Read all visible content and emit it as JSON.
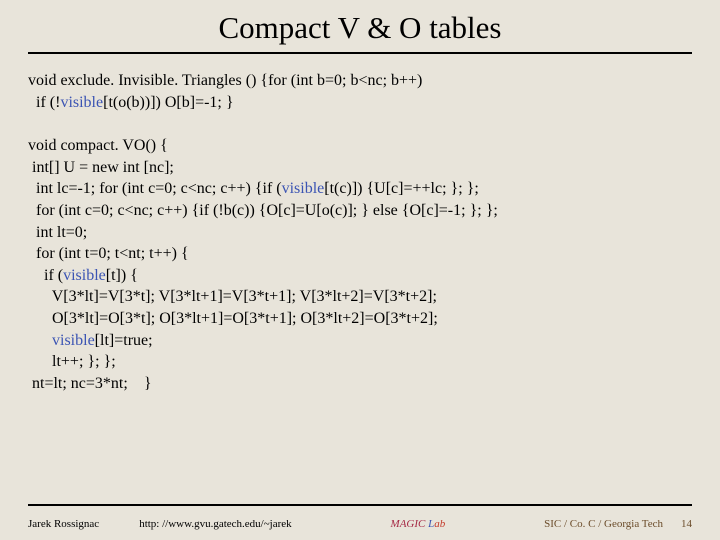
{
  "title": "Compact V & O tables",
  "block1": {
    "l1a": "void exclude. Invisible. Triangles () {for (int b=0; b<nc; b++)",
    "l2a": "  if (!",
    "l2b": "visible",
    "l2c": "[t(o(b))]) O[b]=-1; }"
  },
  "block2": {
    "l1": "void compact. VO() {",
    "l2": " int[] U = new int [nc];",
    "l3a": "  int lc=-1; for (int c=0; c<nc; c++) {if (",
    "l3b": "visible",
    "l3c": "[t(c)]) {U[c]=++lc; }; };",
    "l4": "  for (int c=0; c<nc; c++) {if (!b(c)) {O[c]=U[o(c)]; } else {O[c]=-1; }; };",
    "l5": "  int lt=0;",
    "l6": "  for (int t=0; t<nt; t++) {",
    "l7a": "    if (",
    "l7b": "visible",
    "l7c": "[t]) {",
    "l8": "      V[3*lt]=V[3*t]; V[3*lt+1]=V[3*t+1]; V[3*lt+2]=V[3*t+2];",
    "l9": "      O[3*lt]=O[3*t]; O[3*lt+1]=O[3*t+1]; O[3*lt+2]=O[3*t+2];",
    "l10a": "      ",
    "l10b": "visible",
    "l10c": "[lt]=true;",
    "l11": "      lt++; }; };",
    "l12": " nt=lt; nc=3*nt;    }"
  },
  "footer": {
    "author": "Jarek Rossignac",
    "url": "http: //www.gvu.gatech.edu/~jarek",
    "magic_prefix": "MAGIC ",
    "lab_l": "L",
    "lab_rest": "ab",
    "affil": "SIC / Co. C / Georgia Tech",
    "pagenum": "14"
  }
}
